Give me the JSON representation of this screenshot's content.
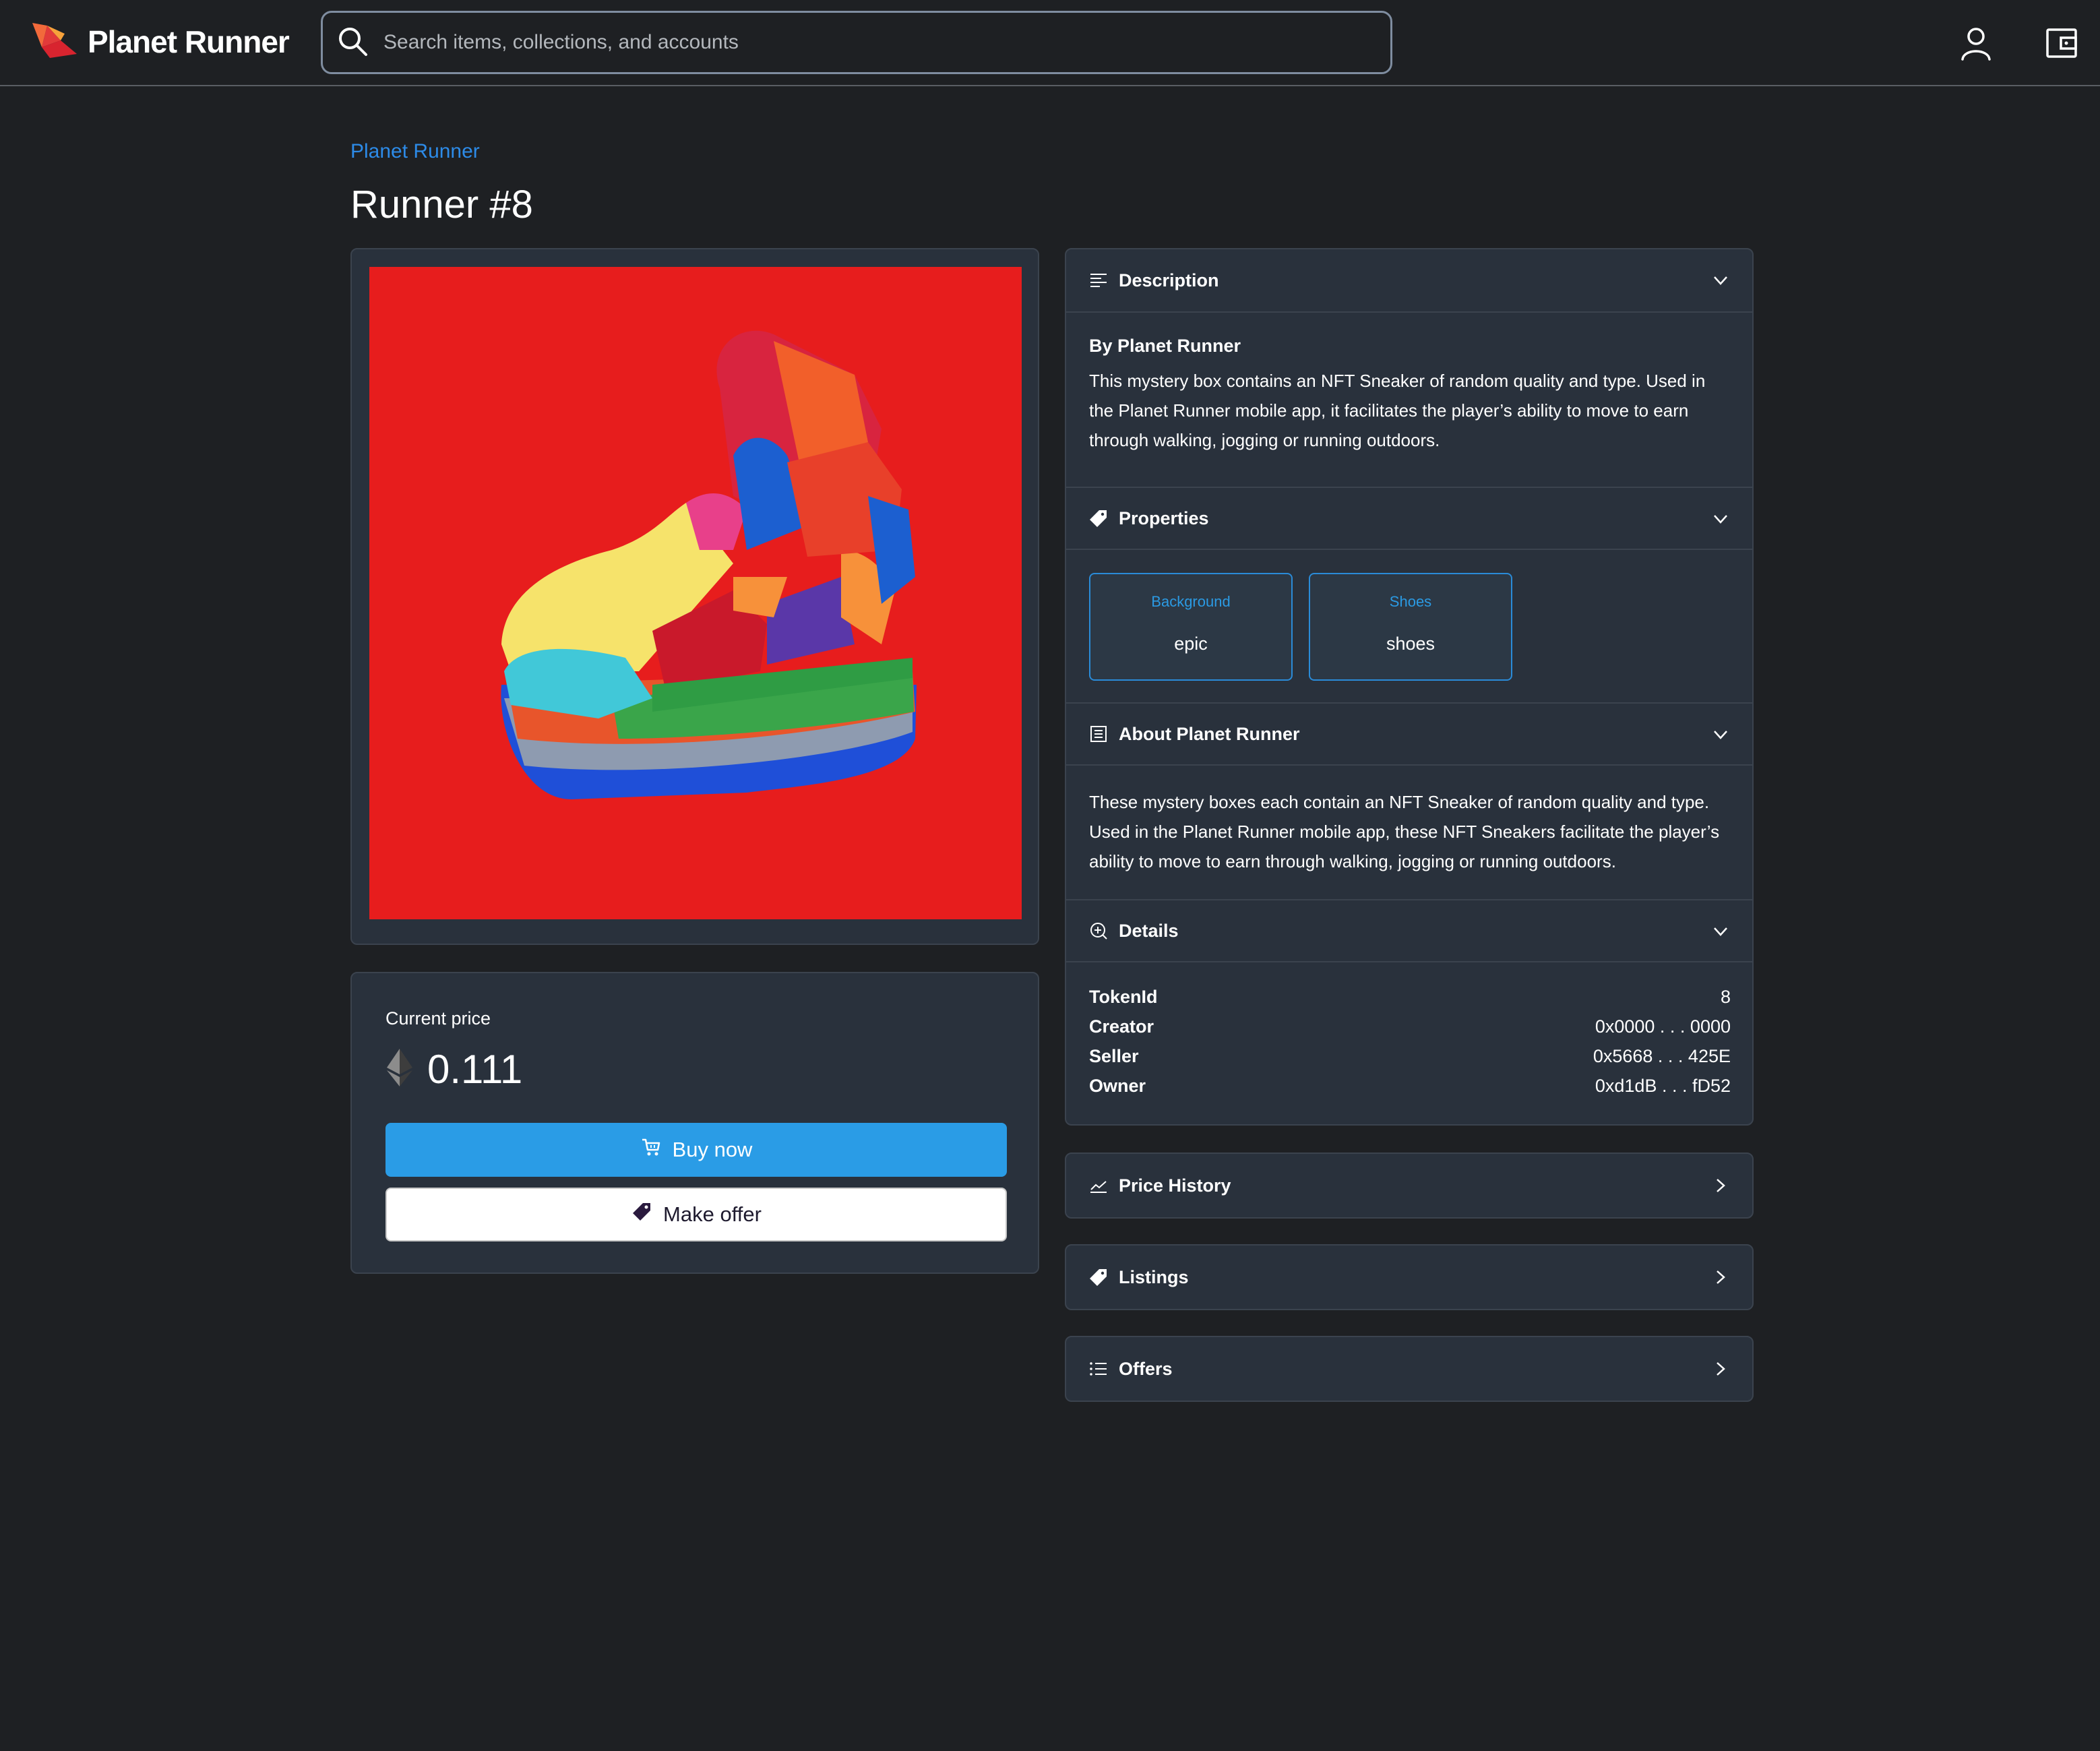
{
  "header": {
    "brand": "Planet Runner",
    "search_placeholder": "Search items, collections, and accounts",
    "icons": [
      "logo-icon",
      "search-icon",
      "account-icon",
      "wallet-icon"
    ]
  },
  "breadcrumb": "Planet Runner",
  "item": {
    "title": "Runner #8"
  },
  "price": {
    "label": "Current price",
    "value": "0.111",
    "currency_icon": "ethereum-icon",
    "buy_label": "Buy now",
    "offer_label": "Make offer"
  },
  "description": {
    "label": "Description",
    "by": "By Planet Runner",
    "text": "This mystery box contains an NFT Sneaker of random quality and type. Used in the Planet Runner mobile app, it facilitates the player’s ability to move to earn through walking, jogging or running outdoors."
  },
  "properties": {
    "label": "Properties",
    "items": [
      {
        "trait": "Background",
        "value": "epic"
      },
      {
        "trait": "Shoes",
        "value": "shoes"
      }
    ]
  },
  "about": {
    "label": "About Planet Runner",
    "text": "These mystery boxes each contain an NFT Sneaker of random quality and type. Used in the Planet Runner mobile app, these NFT Sneakers facilitate the player’s ability to move to earn through walking, jogging or running outdoors."
  },
  "details": {
    "label": "Details",
    "rows": [
      {
        "key": "TokenId",
        "value": "8"
      },
      {
        "key": "Creator",
        "value": "0x0000 . . . 0000"
      },
      {
        "key": "Seller",
        "value": "0x5668 . . . 425E"
      },
      {
        "key": "Owner",
        "value": "0xd1dB . . . fD52"
      }
    ]
  },
  "price_history": {
    "label": "Price History"
  },
  "listings": {
    "label": "Listings"
  },
  "offers": {
    "label": "Offers"
  },
  "colors": {
    "background": "#1e2023",
    "card": "#29313c",
    "accent": "#2a9ce6",
    "link": "#2d8be8",
    "artwork_bg": "#e71d1d"
  }
}
